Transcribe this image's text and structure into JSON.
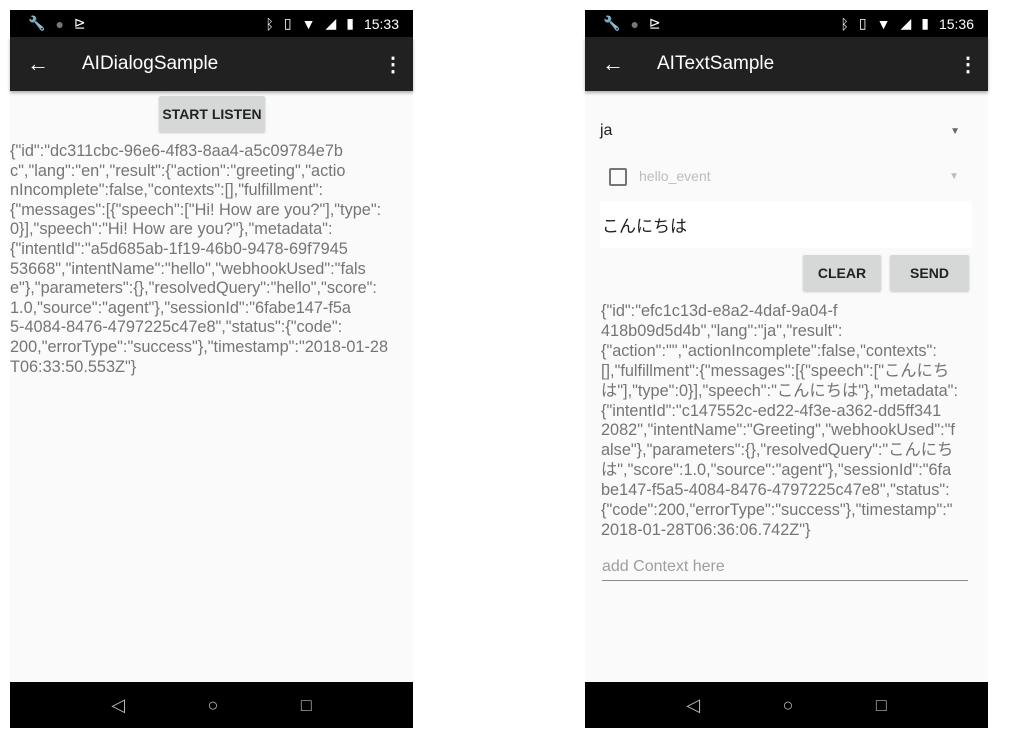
{
  "left": {
    "status_time": "15:33",
    "title": "AIDialogSample",
    "start_listen": "START LISTEN",
    "response_lines": [
      "{\"id\":\"dc311cbc-96e6-4f83-8aa4-a5c09784e7b",
      "c\",\"lang\":\"en\",\"result\":{\"action\":\"greeting\",\"actio",
      "nIncomplete\":false,\"contexts\":[],\"fulfillment\":",
      "{\"messages\":[{\"speech\":[\"Hi! How are you?\"],\"type\":",
      "0}],\"speech\":\"Hi! How are you?\"},\"metadata\":",
      "{\"intentId\":\"a5d685ab-1f19-46b0-9478-69f7945",
      "53668\",\"intentName\":\"hello\",\"webhookUsed\":\"fals",
      "e\"},\"parameters\":{},\"resolvedQuery\":\"hello\",\"score\":",
      "1.0,\"source\":\"agent\"},\"sessionId\":\"6fabe147-f5a",
      "5-4084-8476-4797225c47e8\",\"status\":{\"code\":",
      "200,\"errorType\":\"success\"},\"timestamp\":\"2018-01-28",
      "T06:33:50.553Z\"}"
    ]
  },
  "right": {
    "status_time": "15:36",
    "title": "AITextSample",
    "language": "ja",
    "event_checked": false,
    "event": "hello_event",
    "query": "こんにちは",
    "clear": "CLEAR",
    "send": "SEND",
    "response_lines": [
      "{\"id\":\"efc1c13d-e8a2-4daf-9a04-f",
      "418b09d5d4b\",\"lang\":\"ja\",\"result\":",
      "{\"action\":\"\",\"actionIncomplete\":false,\"contexts\":",
      "[],\"fulfillment\":{\"messages\":[{\"speech\":[\"こんにち",
      "は\"],\"type\":0}],\"speech\":\"こんにちは\"},\"metadata\":",
      "{\"intentId\":\"c147552c-ed22-4f3e-a362-dd5ff341",
      "2082\",\"intentName\":\"Greeting\",\"webhookUsed\":\"f",
      "alse\"},\"parameters\":{},\"resolvedQuery\":\"こんにち",
      "は\",\"score\":1.0,\"source\":\"agent\"},\"sessionId\":\"6fa",
      "be147-f5a5-4084-8476-4797225c47e8\",\"status\":",
      "{\"code\":200,\"errorType\":\"success\"},\"timestamp\":\"",
      "2018-01-28T06:36:06.742Z\"}"
    ],
    "context_placeholder": "add Context here"
  }
}
